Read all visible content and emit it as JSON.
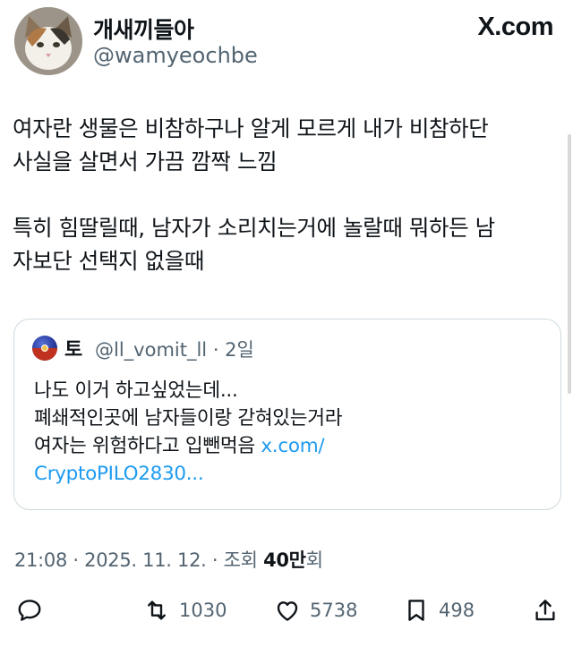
{
  "author": {
    "display_name": "개새끼들아",
    "handle": "@wamyeochbe",
    "avatar": "cat-photo"
  },
  "brand": "X.com",
  "tweet": {
    "text": "여자란 생물은 비참하구나 알게 모르게 내가 비참하단\n사실을 살면서 가끔 깜짝 느낌\n\n특히 힘딸릴때, 남자가 소리치는거에 놀랄때 뭐하든 남\n자보단 선택지 없을때"
  },
  "quote": {
    "name": "토",
    "handle_time": "@ll_vomit_ll · 2일",
    "text": "나도 이거 하고싶었는데...\n폐쇄적인곳에 남자들이랑 갇혀있는거라\n여자는 위험하다고 입뺀먹음 ",
    "link": "x.com/\nCryptoPILO2830..."
  },
  "timestamp": {
    "prefix": "21:08 · 2025. 11. 12. · 조회 ",
    "views": "40만",
    "suffix": "회"
  },
  "actions": {
    "reply": {
      "icon": "reply-icon",
      "count": ""
    },
    "retweet": {
      "icon": "retweet-icon",
      "count": "1030"
    },
    "like": {
      "icon": "heart-icon",
      "count": "5738"
    },
    "bookmark": {
      "icon": "bookmark-icon",
      "count": "498"
    },
    "share": {
      "icon": "share-icon",
      "count": ""
    }
  },
  "colors": {
    "link": "#1d9bf0",
    "muted": "#536471",
    "text": "#0f1419",
    "border": "#cfd9de"
  }
}
